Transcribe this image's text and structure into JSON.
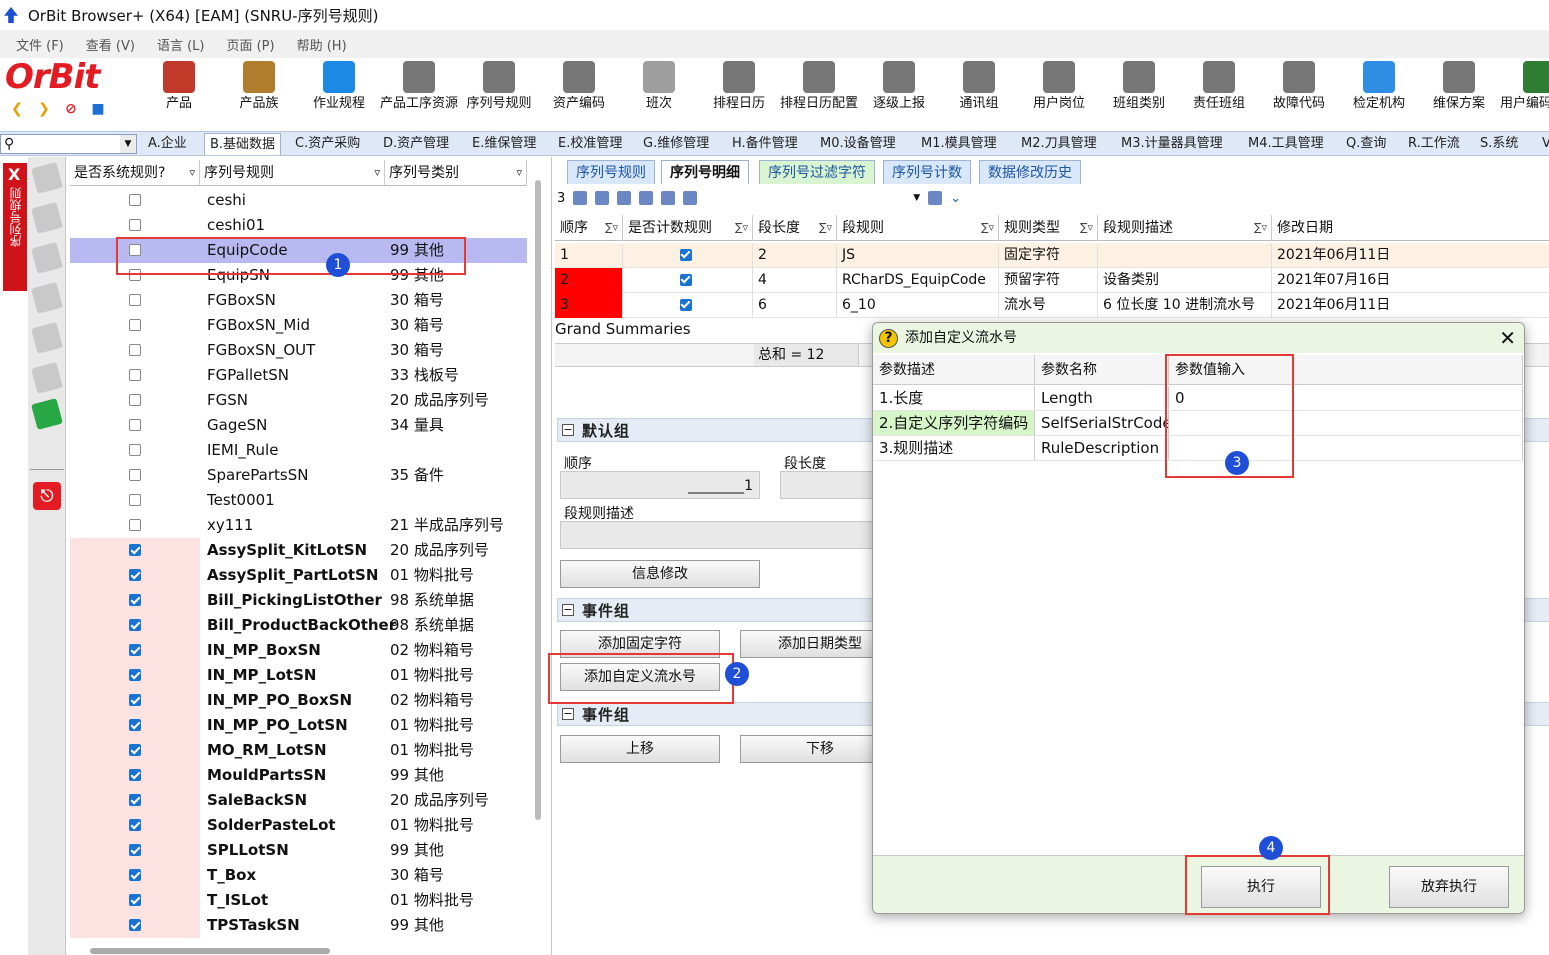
{
  "window": {
    "title": "OrBit Browser+ (X64) [EAM] (SNRU-序列号规则)"
  },
  "menu": [
    "文件 (F)",
    "查看 (V)",
    "语言 (L)",
    "页面 (P)",
    "帮助 (H)"
  ],
  "logo": {
    "text": "OrBit",
    "brand_color": "#e31c23"
  },
  "toolbar": [
    {
      "label": "产品",
      "icon": "product-box-icon",
      "color": "#c0392b"
    },
    {
      "label": "产品族",
      "icon": "product-family-icon",
      "color": "#b07d2e"
    },
    {
      "label": "作业规程",
      "icon": "gear-icon",
      "color": "#1e88e5"
    },
    {
      "label": "产品工序资源",
      "icon": "gear-cube-icon",
      "color": "#777777"
    },
    {
      "label": "序列号规则",
      "icon": "gear-cube-icon",
      "color": "#777777"
    },
    {
      "label": "资产编码",
      "icon": "gear-cube-icon",
      "color": "#777777"
    },
    {
      "label": "班次",
      "icon": "clock-icon",
      "color": "#9e9e9e"
    },
    {
      "label": "排程日历",
      "icon": "gear-cube-icon",
      "color": "#777777"
    },
    {
      "label": "排程日历配置",
      "icon": "gear-cube-icon",
      "color": "#777777"
    },
    {
      "label": "逐级上报",
      "icon": "gear-cube-icon",
      "color": "#777777"
    },
    {
      "label": "通讯组",
      "icon": "gear-cube-icon",
      "color": "#777777"
    },
    {
      "label": "用户岗位",
      "icon": "gear-cube-icon",
      "color": "#777777"
    },
    {
      "label": "班组类别",
      "icon": "gear-cube-icon",
      "color": "#777777"
    },
    {
      "label": "责任班组",
      "icon": "gear-cube-icon",
      "color": "#777777"
    },
    {
      "label": "故障代码",
      "icon": "gear-cube-icon",
      "color": "#777777"
    },
    {
      "label": "检定机构",
      "icon": "user-icon",
      "color": "#2f8de4"
    },
    {
      "label": "维保方案",
      "icon": "gear-cube-icon",
      "color": "#777777"
    },
    {
      "label": "用户编码定义",
      "icon": "books-icon",
      "color": "#2e7d32"
    }
  ],
  "modules": {
    "active": "B.基础数据",
    "tabs": [
      "A.企业",
      "B.基础数据",
      "C.资产采购",
      "D.资产管理",
      "E.维保管理",
      "E.校准管理",
      "G.维修管理",
      "H.备件管理",
      "M0.设备管理",
      "M1.模具管理",
      "M2.刀具管理",
      "M3.计量器具管理",
      "M4.工具管理",
      "Q.查询",
      "R.工作流",
      "S.系统",
      "V"
    ]
  },
  "sidebar_tab": {
    "label": "序列号规则",
    "close": "X"
  },
  "left_grid": {
    "headers": [
      "是否系统规则?",
      "序列号规则",
      "序列号类别"
    ],
    "rows": [
      {
        "checked": false,
        "name": "ceshi",
        "type": "",
        "bold": false
      },
      {
        "checked": false,
        "name": "ceshi01",
        "type": "",
        "bold": false
      },
      {
        "checked": false,
        "name": "EquipCode",
        "type": "99 其他",
        "bold": false,
        "selected": true
      },
      {
        "checked": false,
        "name": "EquipSN",
        "type": "99 其他",
        "bold": false
      },
      {
        "checked": false,
        "name": "FGBoxSN",
        "type": "30 箱号",
        "bold": false
      },
      {
        "checked": false,
        "name": "FGBoxSN_Mid",
        "type": "30 箱号",
        "bold": false
      },
      {
        "checked": false,
        "name": "FGBoxSN_OUT",
        "type": "30 箱号",
        "bold": false
      },
      {
        "checked": false,
        "name": "FGPalletSN",
        "type": "33 栈板号",
        "bold": false
      },
      {
        "checked": false,
        "name": "FGSN",
        "type": "20 成品序列号",
        "bold": false
      },
      {
        "checked": false,
        "name": "GageSN",
        "type": "34 量具",
        "bold": false
      },
      {
        "checked": false,
        "name": "IEMI_Rule",
        "type": "",
        "bold": false
      },
      {
        "checked": false,
        "name": "SparePartsSN",
        "type": "35 备件",
        "bold": false
      },
      {
        "checked": false,
        "name": "Test0001",
        "type": "",
        "bold": false
      },
      {
        "checked": false,
        "name": "xy111",
        "type": "21 半成品序列号",
        "bold": false
      },
      {
        "checked": true,
        "name": "AssySplit_KitLotSN",
        "type": "20 成品序列号",
        "bold": true
      },
      {
        "checked": true,
        "name": "AssySplit_PartLotSN",
        "type": "01 物料批号",
        "bold": true
      },
      {
        "checked": true,
        "name": "Bill_PickingListOther",
        "type": "98 系统单据",
        "bold": true
      },
      {
        "checked": true,
        "name": "Bill_ProductBackOther",
        "type": "98 系统单据",
        "bold": true
      },
      {
        "checked": true,
        "name": "IN_MP_BoxSN",
        "type": "02 物料箱号",
        "bold": true
      },
      {
        "checked": true,
        "name": "IN_MP_LotSN",
        "type": "01 物料批号",
        "bold": true
      },
      {
        "checked": true,
        "name": "IN_MP_PO_BoxSN",
        "type": "02 物料箱号",
        "bold": true
      },
      {
        "checked": true,
        "name": "IN_MP_PO_LotSN",
        "type": "01 物料批号",
        "bold": true
      },
      {
        "checked": true,
        "name": "MO_RM_LotSN",
        "type": "01 物料批号",
        "bold": true
      },
      {
        "checked": true,
        "name": "MouldPartsSN",
        "type": "99 其他",
        "bold": true
      },
      {
        "checked": true,
        "name": "SaleBackSN",
        "type": "20 成品序列号",
        "bold": true
      },
      {
        "checked": true,
        "name": "SolderPasteLot",
        "type": "01 物料批号",
        "bold": true
      },
      {
        "checked": true,
        "name": "SPLLotSN",
        "type": "99 其他",
        "bold": true
      },
      {
        "checked": true,
        "name": "T_Box",
        "type": "30 箱号",
        "bold": true
      },
      {
        "checked": true,
        "name": "T_ISLot",
        "type": "01 物料批号",
        "bold": true
      },
      {
        "checked": true,
        "name": "TPSTaskSN",
        "type": "99 其他",
        "bold": true
      }
    ]
  },
  "right_tabs": [
    "序列号规则",
    "序列号明细",
    "序列号过滤字符",
    "序列号计数",
    "数据修改历史"
  ],
  "right_tabs_active": "序列号明细",
  "record_count": "3",
  "detail_grid": {
    "headers": [
      "顺序",
      "是否计数规则",
      "段长度",
      "段规则",
      "规则类型",
      "段规则描述",
      "修改日期"
    ],
    "rows": [
      {
        "seq": "1",
        "counted": true,
        "len": "2",
        "rule": "JS",
        "type": "固定字符",
        "desc": "",
        "date": "2021年06月11日"
      },
      {
        "seq": "2",
        "counted": true,
        "len": "4",
        "rule": "RCharDS_EquipCode",
        "type": "预留字符",
        "desc": "设备类别",
        "date": "2021年07月16日"
      },
      {
        "seq": "3",
        "counted": true,
        "len": "6",
        "rule": "6_10",
        "type": "流水号",
        "desc": "6 位长度 10 进制流水号",
        "date": "2021年06月11日"
      }
    ],
    "grand_summaries": "Grand Summaries",
    "sum_text": "总和 = 12"
  },
  "default_group": {
    "title": "默认组",
    "seq_label": "顺序",
    "seq_value": "________1",
    "len_label": "段长度",
    "desc_label": "段规则描述",
    "modify_button": "信息修改"
  },
  "event_group1": {
    "title": "事件组",
    "add_fixed": "添加固定字符",
    "add_date": "添加日期类型",
    "add_custom": "添加自定义流水号"
  },
  "event_group2": {
    "title": "事件组",
    "move_up": "上移",
    "move_down": "下移"
  },
  "dialog": {
    "title": "添加自定义流水号",
    "close": "✕",
    "headers": [
      "参数描述",
      "参数名称",
      "参数值输入"
    ],
    "rows": [
      {
        "desc": "1.长度",
        "name": "Length",
        "value": "0"
      },
      {
        "desc": "2.自定义序列字符编码",
        "name": "SelfSerialStrCode",
        "value": ""
      },
      {
        "desc": "3.规则描述",
        "name": "RuleDescription",
        "value": ""
      }
    ],
    "execute": "执行",
    "cancel": "放弃执行"
  },
  "annotations": [
    "1",
    "2",
    "3",
    "4"
  ]
}
